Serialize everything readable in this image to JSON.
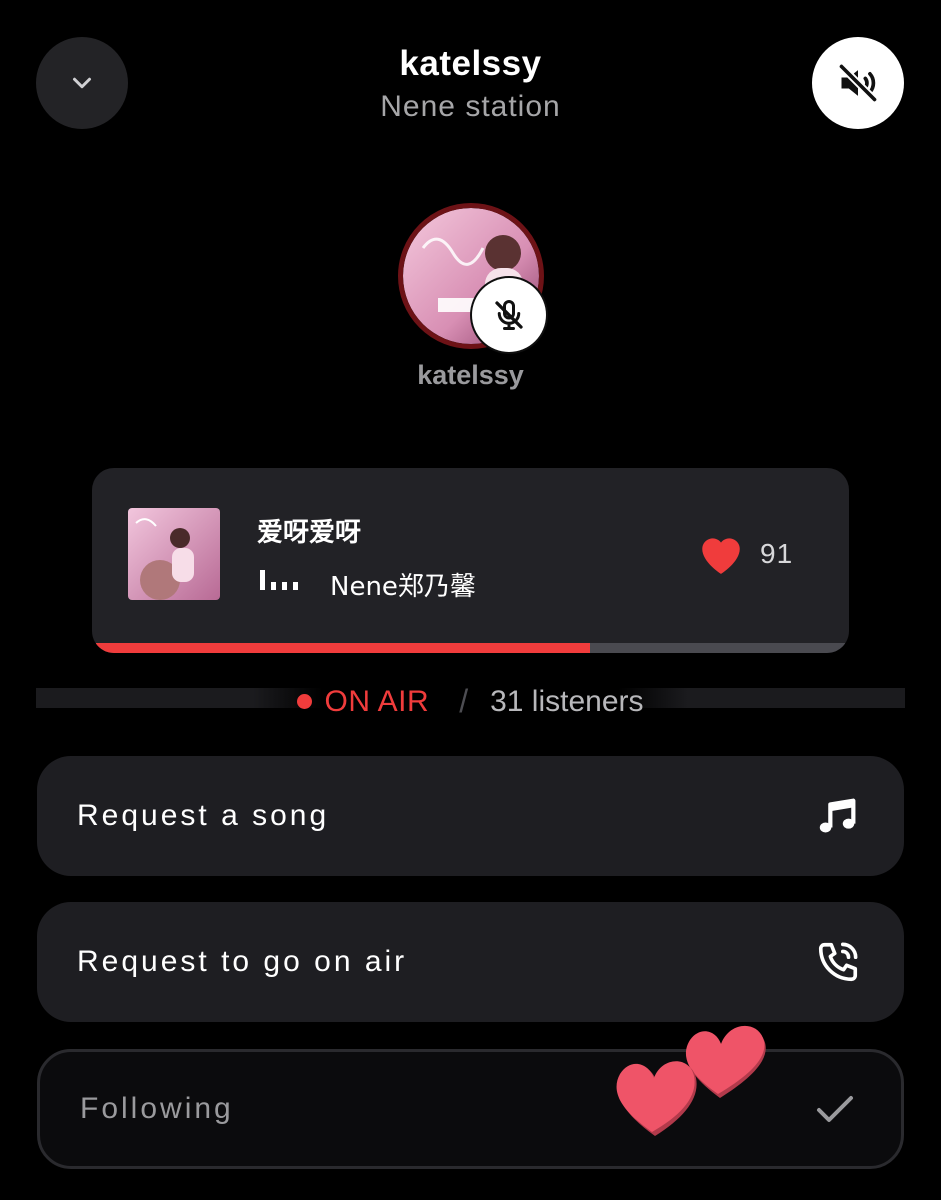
{
  "header": {
    "title": "katelssy",
    "subtitle": "Nene station"
  },
  "host": {
    "name": "katelssy",
    "avatar_icon": "album-cover-avatar",
    "mic_status_icon": "mic-off-icon"
  },
  "now_playing": {
    "title": "爱呀爱呀",
    "artist": "Nene郑乃馨",
    "likes": "91",
    "progress": 0.66
  },
  "status": {
    "on_air": "ON AIR",
    "separator": "/",
    "listeners": "31 listeners"
  },
  "actions": {
    "request_song": "Request a song",
    "request_air": "Request to go on air",
    "following": "Following"
  },
  "colors": {
    "accent": "#f03c3c",
    "heart": "#f03c3c",
    "background": "#000000",
    "card": "#222226"
  }
}
